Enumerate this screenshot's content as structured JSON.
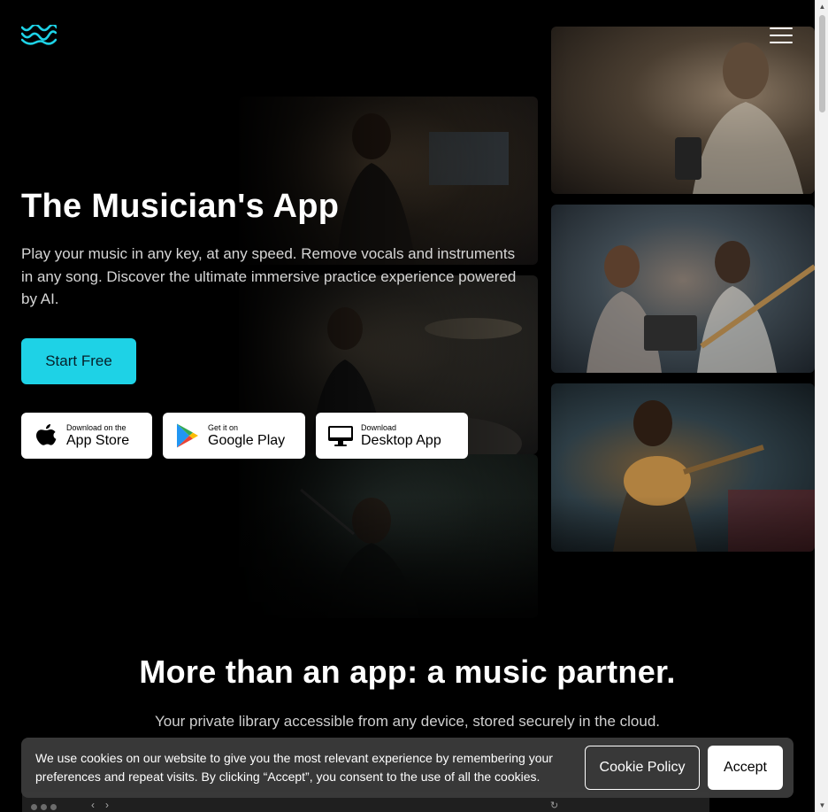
{
  "header": {
    "logo_icon": "wave-logo-icon",
    "menu_icon": "hamburger-menu-icon"
  },
  "hero": {
    "title": "The Musician's App",
    "subtitle": "Play your music in any key, at any speed. Remove vocals and instruments in any song. Discover the ultimate immersive practice experience powered by AI.",
    "cta_label": "Start Free",
    "stores": [
      {
        "small": "Download on the",
        "big": "App Store",
        "icon": "apple-icon"
      },
      {
        "small": "Get it on",
        "big": "Google Play",
        "icon": "google-play-icon"
      },
      {
        "small": "Download",
        "big": "Desktop App",
        "icon": "desktop-monitor-icon"
      }
    ]
  },
  "section": {
    "title": "More than an app: a music partner.",
    "subtitle": "Your private library accessible from any device, stored securely in the cloud."
  },
  "cookie": {
    "text": "We use cookies on our website to give you the most relevant experience by remembering your preferences and repeat visits. By clicking “Accept”, you consent to the use of all the cookies.",
    "policy_label": "Cookie Policy",
    "accept_label": "Accept"
  },
  "colors": {
    "accent": "#1ed2e6",
    "background": "#000000",
    "cookie_bg": "#3c3c3c"
  }
}
